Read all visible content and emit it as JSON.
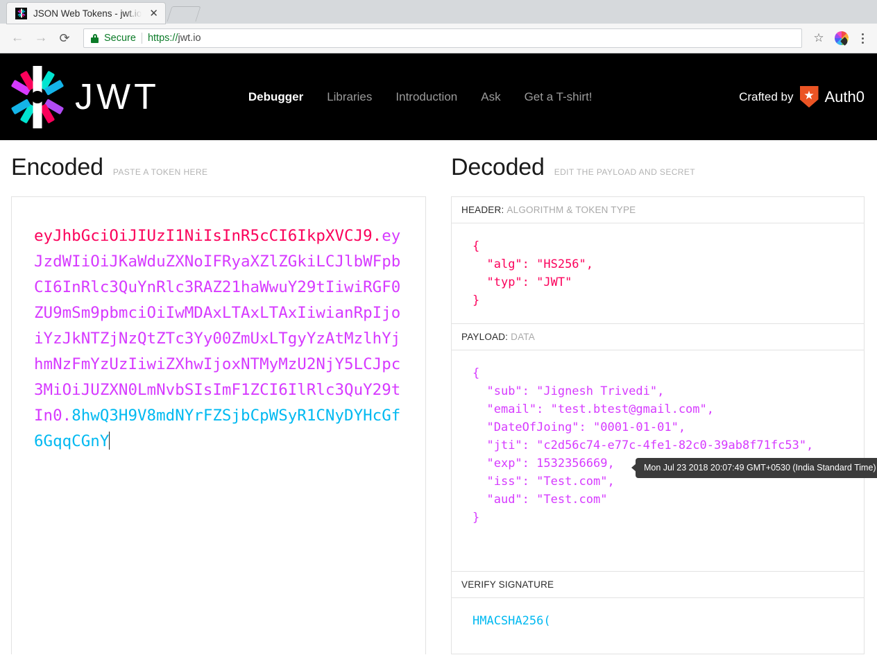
{
  "browser": {
    "tab_title": "JSON Web Tokens - jwt.io",
    "tab_close_glyph": "✕",
    "back_glyph": "←",
    "forward_glyph": "→",
    "reload_glyph": "⟳",
    "security_label": "Secure",
    "url_scheme": "https://",
    "url_host": "jwt.io",
    "star_glyph": "☆"
  },
  "site": {
    "wordmark": "JWT",
    "nav": [
      {
        "label": "Debugger",
        "active": true
      },
      {
        "label": "Libraries",
        "active": false
      },
      {
        "label": "Introduction",
        "active": false
      },
      {
        "label": "Ask",
        "active": false
      },
      {
        "label": "Get a T-shirt!",
        "active": false
      }
    ],
    "crafted_by": "Crafted by",
    "auth0_name": "Auth0",
    "auth0_star_glyph": "★"
  },
  "encoded": {
    "title": "Encoded",
    "subtitle": "PASTE A TOKEN HERE",
    "token_header": "eyJhbGciOiJIUzI1NiIsInR5cCI6IkpXVCJ9",
    "token_payload": "eyJzdWIiOiJKaWduZXNoIFRyaXZlZGkiLCJlbWFpbCI6InRlc3QuYnRlc3RAZ21haWwuY29tIiwiRGF0ZU9mSm9pbmciOiIwMDAxLTAxLTAxIiwianRpIjoiYzJkNTZjNzQtZTc3Yy00ZmUxLTgyYzAtMzlhYjhmNzFmYzUzIiwiZXhwIjoxNTMyMzU2NjY5LCJpc3MiOiJUZXN0LmNvbSIsImF1ZCI6IlRlc3QuY29tIn0",
    "token_signature": "8hwQ3H9V8mdNYrFZSjbCpWSyR1CNyDYHcGf6GqqCGnY",
    "dot": "."
  },
  "decoded": {
    "title": "Decoded",
    "subtitle": "EDIT THE PAYLOAD AND SECRET",
    "header_section": {
      "label": "HEADER:",
      "hint": "ALGORITHM & TOKEN TYPE",
      "json": "{\n  \"alg\": \"HS256\",\n  \"typ\": \"JWT\"\n}"
    },
    "payload_section": {
      "label": "PAYLOAD:",
      "hint": "DATA",
      "json": "{\n  \"sub\": \"Jignesh Trivedi\",\n  \"email\": \"test.btest@gmail.com\",\n  \"DateOfJoing\": \"0001-01-01\",\n  \"jti\": \"c2d56c74-e77c-4fe1-82c0-39ab8f71fc53\",\n  \"exp\": 1532356669,\n  \"iss\": \"Test.com\",\n  \"aud\": \"Test.com\"\n}",
      "exp_tooltip": "Mon Jul 23 2018 20:07:49 GMT+0530 (India Standard Time)"
    },
    "signature_section": {
      "label": "VERIFY SIGNATURE",
      "hint": "",
      "code": "HMACSHA256("
    }
  },
  "colors": {
    "header_segment": "#fb015b",
    "payload_segment": "#d63aff",
    "signature_segment": "#00b9f1",
    "brand_black": "#000000",
    "auth0_orange": "#eb5424",
    "secure_green": "#0b7b28"
  }
}
